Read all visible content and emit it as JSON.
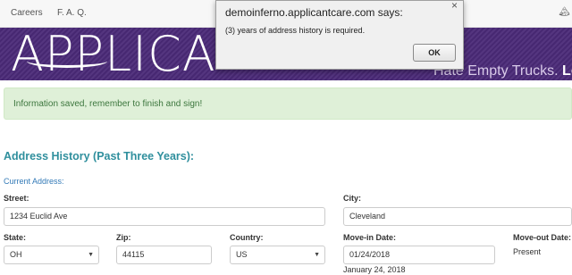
{
  "nav": {
    "careers": "Careers",
    "faq": "F. A. Q.",
    "right_icon": "🏔"
  },
  "banner": {
    "logo_text": "APPLICA",
    "tagline_plain": "Hate Empty Trucks.",
    "tagline_bold": "Lov"
  },
  "alert": {
    "message": "Information saved, remember to finish and sign!"
  },
  "form": {
    "section_title": "Address History (Past Three Years):",
    "subhead": "Current Address:",
    "street": {
      "label": "Street:",
      "value": "1234 Euclid Ave"
    },
    "city": {
      "label": "City:",
      "value": "Cleveland"
    },
    "state": {
      "label": "State:",
      "value": "OH"
    },
    "zip": {
      "label": "Zip:",
      "value": "44115"
    },
    "country": {
      "label": "Country:",
      "value": "US"
    },
    "move_in": {
      "label": "Move-in Date:",
      "value": "01/24/2018",
      "display": "January 24, 2018"
    },
    "move_out": {
      "label": "Move-out Date:",
      "value": "Present"
    }
  },
  "dialog": {
    "title": "demoinferno.applicantcare.com says:",
    "message": "(3) years of address history is required.",
    "ok_label": "OK",
    "close_glyph": "×"
  }
}
